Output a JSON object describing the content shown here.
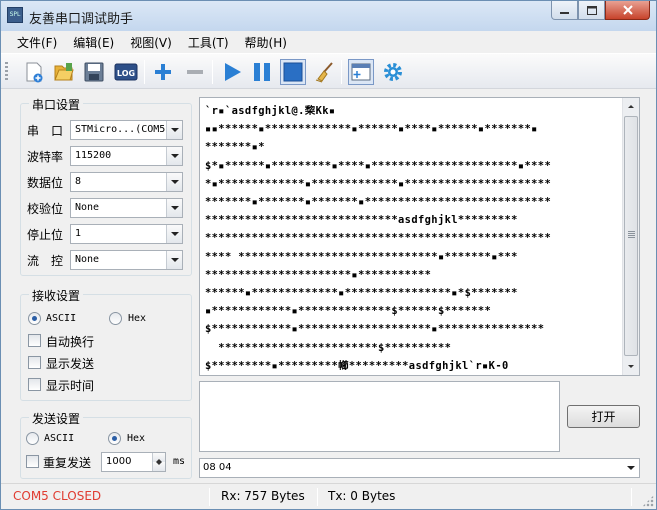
{
  "window": {
    "title": "友善串口调试助手",
    "app_icon_text": "SPL",
    "controls": [
      "minimize",
      "maximize",
      "close"
    ]
  },
  "menu": [
    "文件(F)",
    "编辑(E)",
    "视图(V)",
    "工具(T)",
    "帮助(H)"
  ],
  "toolbar": {
    "log_label": "LOG",
    "icons": [
      "new-icon",
      "open-folder-icon",
      "save-icon",
      "log-icon",
      "add-icon",
      "remove-icon",
      "play-icon",
      "pause-icon",
      "stop-icon",
      "clear-broom-icon",
      "window-icon",
      "settings-gear-icon"
    ]
  },
  "serial_settings": {
    "title": "串口设置",
    "port_label": "串　口",
    "port_value": "STMicro...(COM5",
    "baud_label": "波特率",
    "baud_value": "115200",
    "databits_label": "数据位",
    "databits_value": "8",
    "parity_label": "校验位",
    "parity_value": "None",
    "stopbits_label": "停止位",
    "stopbits_value": "1",
    "flow_label": "流　控",
    "flow_value": "None"
  },
  "receive_settings": {
    "title": "接收设置",
    "ascii_label": "ASCII",
    "hex_label": "Hex",
    "selected": "ASCII",
    "auto_wrap_label": "自动换行",
    "show_send_label": "显示发送",
    "show_time_label": "显示时间"
  },
  "send_settings": {
    "title": "发送设置",
    "ascii_label": "ASCII",
    "hex_label": "Hex",
    "selected": "Hex",
    "repeat_label": "重复发送",
    "interval_value": "1000",
    "unit_label": "ms"
  },
  "receive_area": {
    "lines": [
      "`r▪`asdfghjkl@.棃Kk▪",
      "▪▪******▪*************▪******▪****▪******▪*******▪",
      "*******▪*",
      "$*▪******▪*********▪****▪**********************▪****",
      "*▪*************▪*************▪**********************",
      "*******▪*******▪*******▪****************************",
      "*****************************asdfghjkl*********",
      "****************************************************",
      "**** ******************************▪*******▪***",
      "**********************▪***********",
      "******▪*************▪****************▪*$*******",
      "▪************▪**************$******$*******",
      "$************▪********************▪****************",
      "  ************************$**********",
      "$*********▪*********幯*********asdfghjkl`r▪K-0"
    ]
  },
  "send_area": {
    "value": ""
  },
  "open_button_label": "打开",
  "bottom_combo_value": "08 04",
  "statusbar": {
    "port_status": "COM5 CLOSED",
    "port_status_color": "#e03c31",
    "rx": "Rx: 757 Bytes",
    "tx": "Tx: 0 Bytes"
  }
}
